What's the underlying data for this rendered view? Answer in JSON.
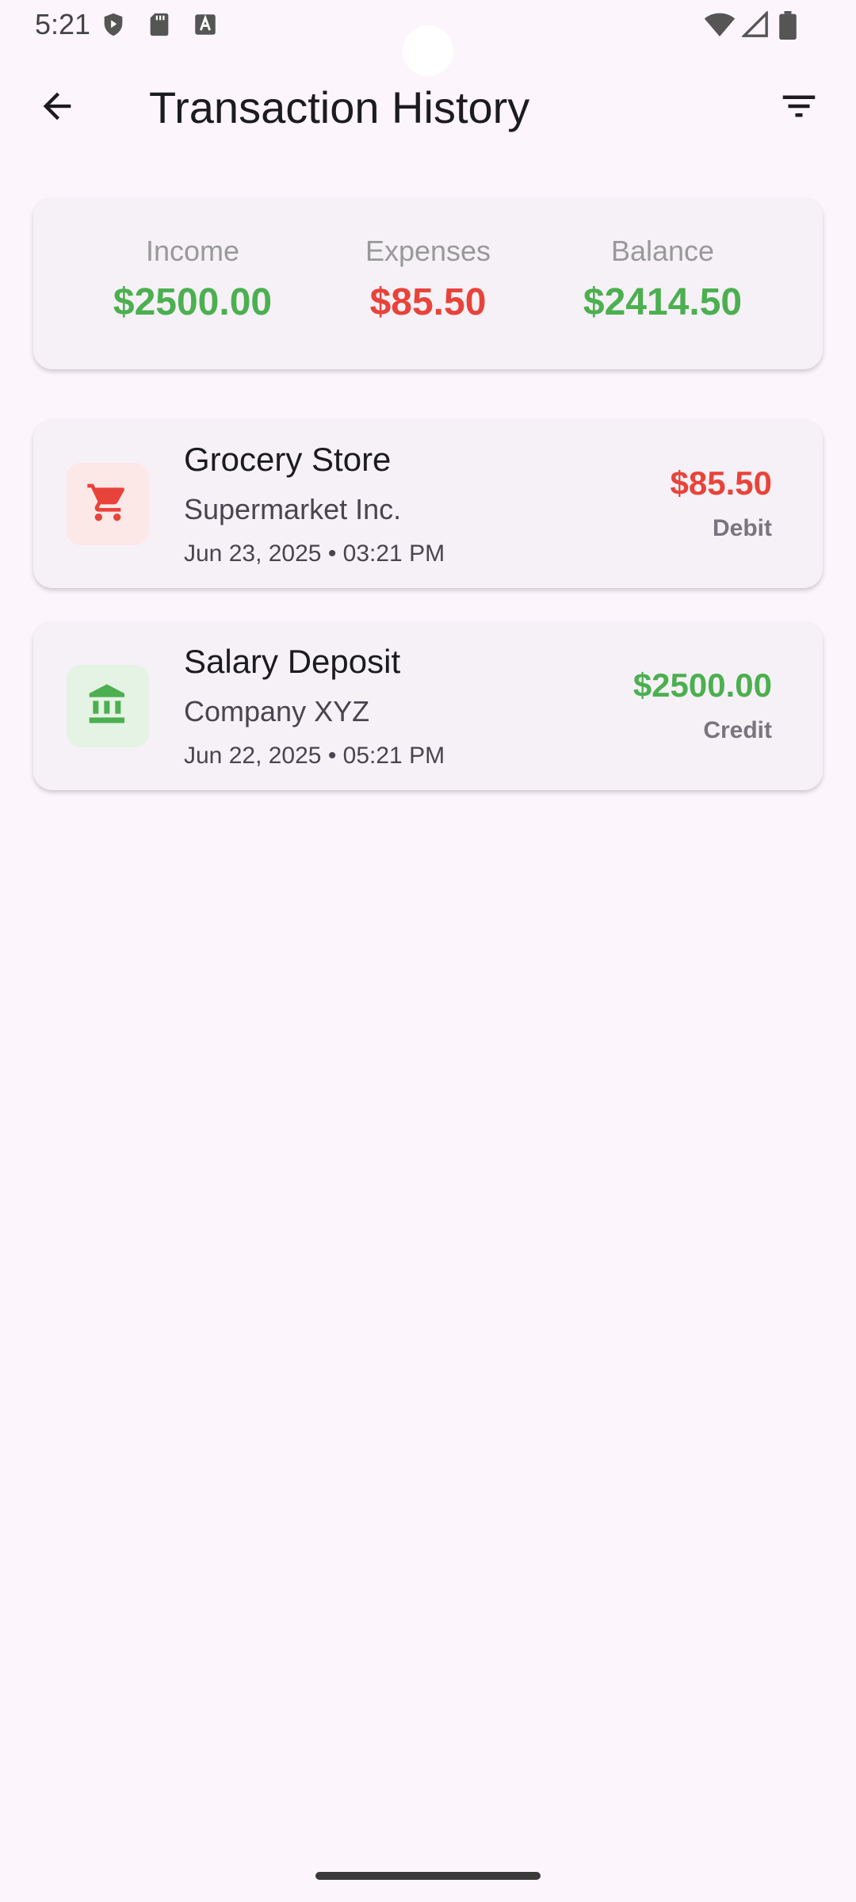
{
  "status_bar": {
    "time": "5:21",
    "icons": [
      "shield-icon",
      "sd-card-icon",
      "accessibility-icon",
      "wifi-icon",
      "signal-icon",
      "battery-icon"
    ]
  },
  "app_bar": {
    "title": "Transaction History",
    "back_icon": "arrow-back-icon",
    "filter_icon": "filter-list-icon"
  },
  "summary": {
    "income_label": "Income",
    "income_value": "$2500.00",
    "expenses_label": "Expenses",
    "expenses_value": "$85.50",
    "balance_label": "Balance",
    "balance_value": "$2414.50"
  },
  "transactions": [
    {
      "title": "Grocery Store",
      "merchant": "Supermarket Inc.",
      "date": "Jun 23, 2025 • 03:21 PM",
      "amount": "$85.50",
      "type": "Debit",
      "icon": "shopping-cart-icon",
      "color": "#e8433a"
    },
    {
      "title": "Salary Deposit",
      "merchant": "Company XYZ",
      "date": "Jun 22, 2025 • 05:21 PM",
      "amount": "$2500.00",
      "type": "Credit",
      "icon": "bank-icon",
      "color": "#4caf50"
    }
  ],
  "colors": {
    "background": "#fcf5fc",
    "card": "#f5f1f6",
    "income": "#4caf50",
    "expense": "#e8433a"
  }
}
